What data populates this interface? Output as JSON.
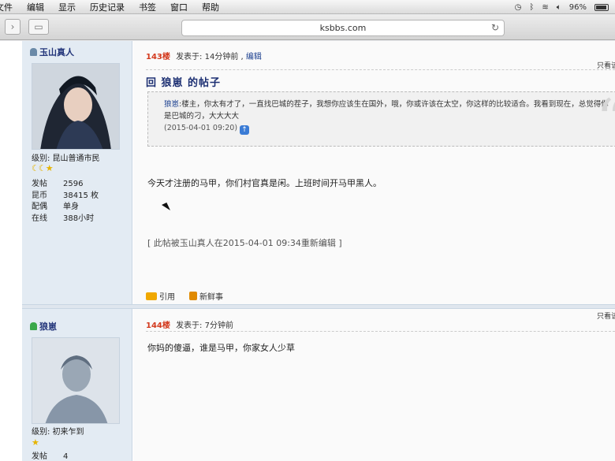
{
  "menubar": {
    "items": [
      "文件",
      "编辑",
      "显示",
      "历史记录",
      "书签",
      "窗口",
      "帮助"
    ],
    "battery": "96%"
  },
  "browser": {
    "url": "ksbbs.com"
  },
  "posts": [
    {
      "user": {
        "name": "玉山真人",
        "level": "级别: 昆山普通市民",
        "stats": [
          {
            "k": "发帖",
            "v": "2596"
          },
          {
            "k": "昆币",
            "v": "38415 枚"
          },
          {
            "k": "配偶",
            "v": "单身"
          },
          {
            "k": "在线",
            "v": "388小时"
          }
        ]
      },
      "floor": "143楼",
      "posted": "发表于: 14分钟前",
      "edit_link": "编辑",
      "only_view": "只看该",
      "title": "回 狼崽 的帖子",
      "quote": {
        "author": "狼崽",
        "text": ":楼主，你太有才了，一直找巴城的茬子，我想你应该生在国外，哦，你或许该在太空，你这样的比较适合。我看到现在，总觉得你是巴城的刁，大大大大",
        "time": "(2015-04-01 09:20)"
      },
      "content": "今天才注册的马甲，你们村官真是闲。上班时间开马甲黑人。",
      "edited_note": "[ 此帖被玉山真人在2015-04-01 09:34重新编辑 ]",
      "actions": {
        "quote": "引用",
        "share": "新鲜事"
      }
    },
    {
      "user": {
        "name": "狼崽",
        "level": "级别: 初来乍到",
        "stats": [
          {
            "k": "发帖",
            "v": "4"
          }
        ]
      },
      "floor": "144楼",
      "posted": "发表于: 7分钟前",
      "only_view": "只看该",
      "content": "你妈的傻逼，谁是马甲，你家女人少草"
    }
  ],
  "colors": {
    "floor": "#d33a1e",
    "link": "#1b3f8f",
    "sidebar_bg": "#e3ebf3"
  }
}
